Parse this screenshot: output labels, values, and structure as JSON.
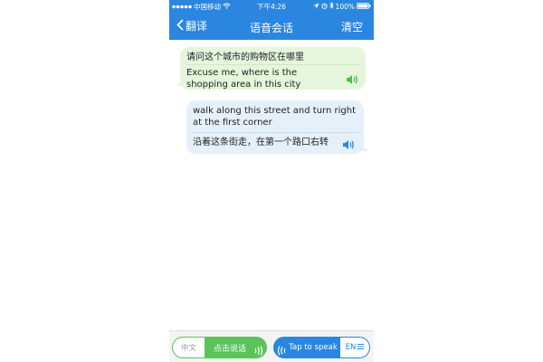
{
  "status_bar": {
    "carrier": "中国移动",
    "time": "下午4:26",
    "battery": "100%"
  },
  "nav": {
    "back_label": "翻译",
    "title": "语音会话",
    "clear_label": "清空"
  },
  "messages": [
    {
      "source": "请问这个城市的购物区在哪里",
      "translation": "Excuse me, where is the shopping area in this city"
    },
    {
      "source": "walk along this street and turn right at the first corner",
      "translation": "沿着这条街走，在第一个路口右转"
    }
  ],
  "bottom": {
    "cn_lang": "中文",
    "cn_button": "点击说话",
    "en_button": "Tap to speak",
    "en_lang": "EN"
  },
  "colors": {
    "nav_blue": "#2b86e0",
    "green": "#5ac45a",
    "left_bubble": "#e5f6dc",
    "right_bubble": "#e6f0fb"
  }
}
